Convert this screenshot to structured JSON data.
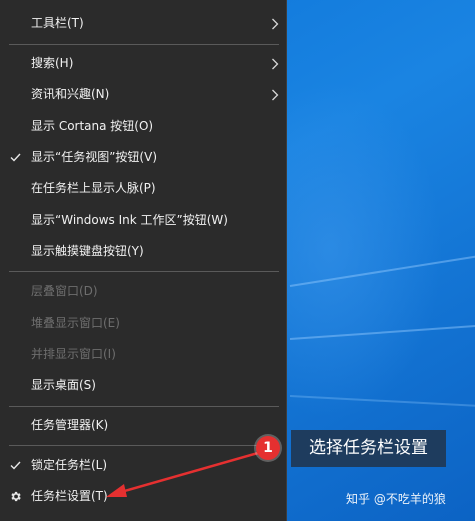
{
  "menu": {
    "items": [
      {
        "label": "工具栏(T)",
        "submenu": true,
        "checked": false,
        "disabled": false
      },
      {
        "label": "搜索(H)",
        "submenu": true,
        "checked": false,
        "disabled": false
      },
      {
        "label": "资讯和兴趣(N)",
        "submenu": true,
        "checked": false,
        "disabled": false
      },
      {
        "label": "显示 Cortana 按钮(O)",
        "submenu": false,
        "checked": false,
        "disabled": false
      },
      {
        "label": "显示“任务视图”按钮(V)",
        "submenu": false,
        "checked": true,
        "disabled": false
      },
      {
        "label": "在任务栏上显示人脉(P)",
        "submenu": false,
        "checked": false,
        "disabled": false
      },
      {
        "label": "显示“Windows Ink 工作区”按钮(W)",
        "submenu": false,
        "checked": false,
        "disabled": false
      },
      {
        "label": "显示触摸键盘按钮(Y)",
        "submenu": false,
        "checked": false,
        "disabled": false
      },
      {
        "label": "层叠窗口(D)",
        "submenu": false,
        "checked": false,
        "disabled": true
      },
      {
        "label": "堆叠显示窗口(E)",
        "submenu": false,
        "checked": false,
        "disabled": true
      },
      {
        "label": "并排显示窗口(I)",
        "submenu": false,
        "checked": false,
        "disabled": true
      },
      {
        "label": "显示桌面(S)",
        "submenu": false,
        "checked": false,
        "disabled": false
      },
      {
        "label": "任务管理器(K)",
        "submenu": false,
        "checked": false,
        "disabled": false
      },
      {
        "label": "锁定任务栏(L)",
        "submenu": false,
        "checked": true,
        "disabled": false
      },
      {
        "label": "任务栏设置(T)",
        "submenu": false,
        "checked": false,
        "disabled": false,
        "icon": "gear-icon"
      }
    ]
  },
  "callout": {
    "number": "1",
    "text": "选择任务栏设置"
  },
  "watermark": "知乎 @不吃羊的狼",
  "colors": {
    "menu_bg": "#2b2b2b",
    "desktop": "#0a66c8",
    "callout_red": "#e53030",
    "tooltip_bg": "#1e3c5e"
  }
}
